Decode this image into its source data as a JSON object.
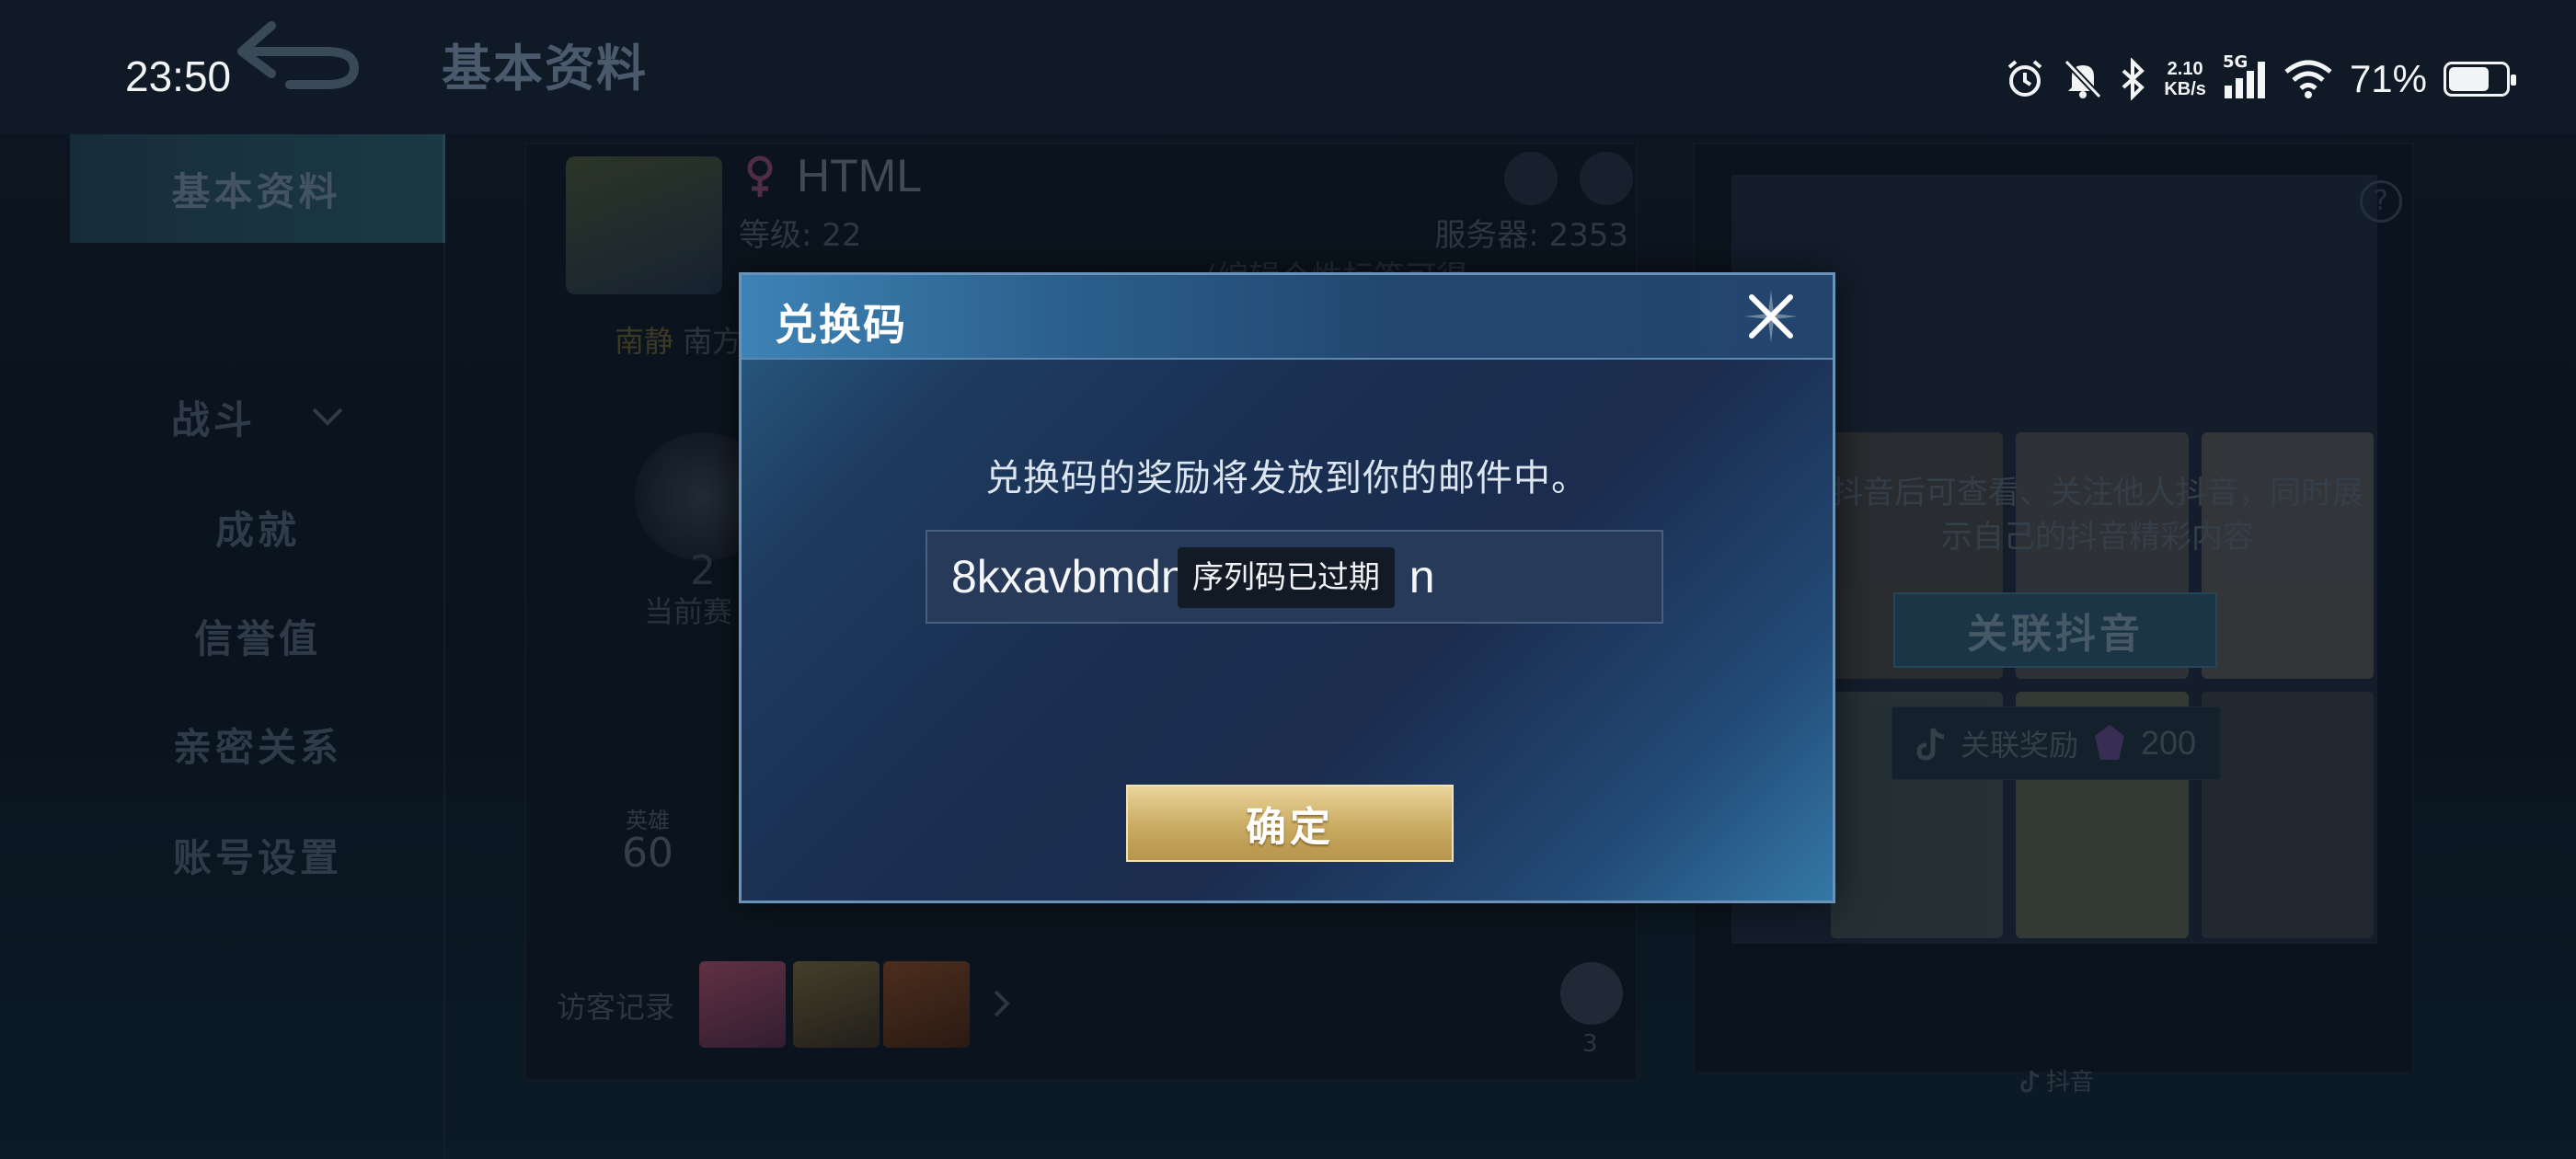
{
  "status_bar": {
    "time": "23:50",
    "net_speed_value": "2.10",
    "net_speed_unit": "KB/s",
    "network_type": "5G",
    "battery_percent": "71%",
    "battery_level": 0.71
  },
  "header": {
    "title": "基本资料"
  },
  "sidebar": {
    "items": [
      {
        "label": "基本资料",
        "active": true
      },
      {
        "label": "战斗"
      },
      {
        "label": "成就"
      },
      {
        "label": "信誉值"
      },
      {
        "label": "亲密关系"
      },
      {
        "label": "账号设置"
      }
    ]
  },
  "profile": {
    "name": "HTML",
    "level": "等级: 22",
    "server": "服务器: 2353",
    "edit_hint": "(编辑个性标签可得",
    "region_a": "南静",
    "region_b": "南方",
    "season_rank": "2",
    "season_label": "当前赛",
    "hero_label": "英雄",
    "hero_count": "60",
    "visitors_label": "访客记录",
    "likes": "3"
  },
  "douyin_panel": {
    "description": "抖音后可查看、关注他人抖音，同时展示自己的抖音精彩内容",
    "link_button": "关联抖音",
    "reward_label": "关联奖励",
    "reward_amount": "200",
    "footer": "抖音"
  },
  "dialog": {
    "title": "兑换码",
    "description": "兑换码的奖励将发放到你的邮件中。",
    "code_value": "8kxavbmdn",
    "code_value_tail": "n",
    "toast": "序列码已过期",
    "confirm_label": "确定"
  }
}
